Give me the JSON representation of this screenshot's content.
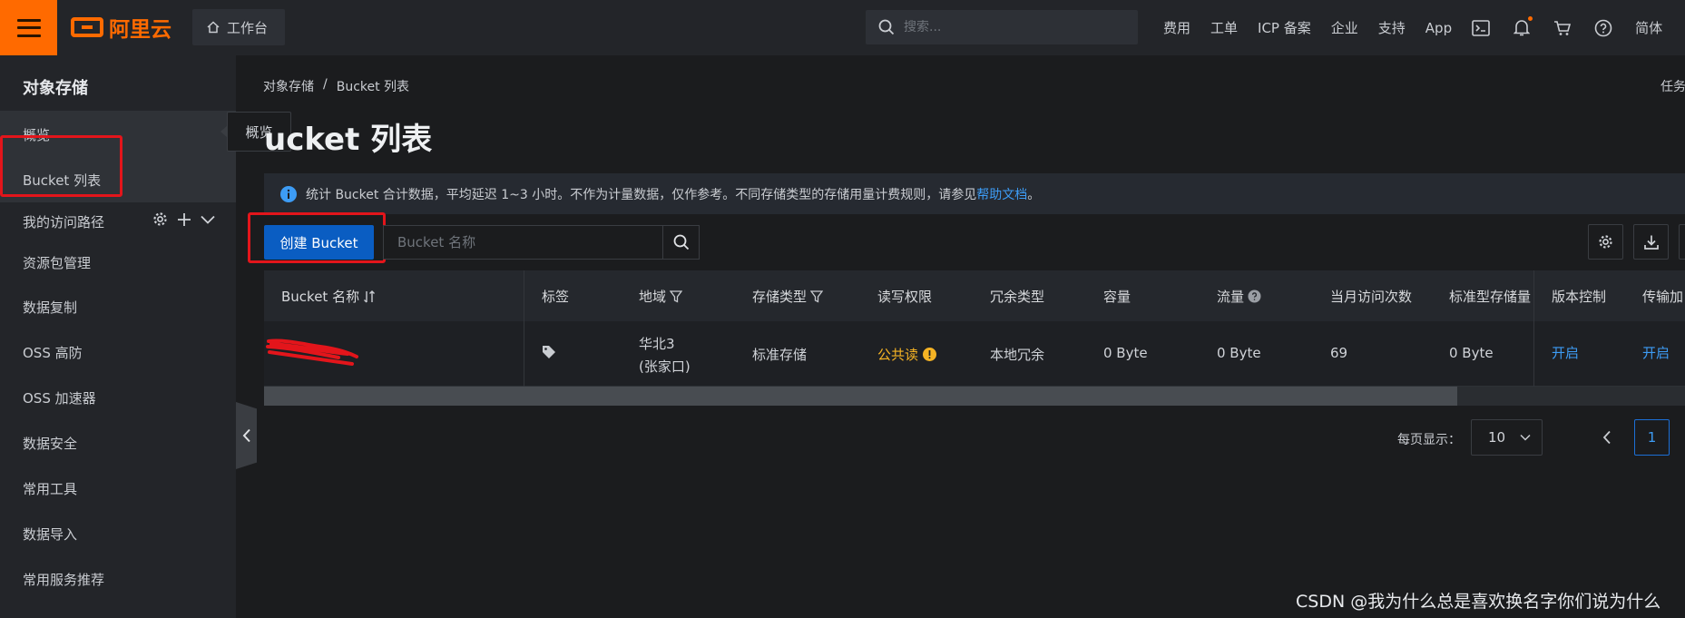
{
  "topbar": {
    "brand": "阿里云",
    "workbench": "工作台",
    "search_placeholder": "搜索...",
    "nav": [
      "费用",
      "工单",
      "ICP 备案",
      "企业",
      "支持",
      "App"
    ],
    "lang": "简体"
  },
  "sidebar": {
    "title": "对象存储",
    "items": {
      "overview": "概览",
      "bucket_list": "Bucket 列表",
      "my_routes": "我的访问路径",
      "resource_pkg": "资源包管理",
      "replication": "数据复制",
      "oss_ddos": "OSS 高防",
      "accelerator": "OSS 加速器",
      "security": "数据安全",
      "tools": "常用工具",
      "import": "数据导入",
      "recommend": "常用服务推荐"
    },
    "tooltip": "概览"
  },
  "main": {
    "breadcrumb": [
      "对象存储",
      "/",
      "Bucket 列表"
    ],
    "tasks": "任务",
    "title": "ucket 列表",
    "notice_text": "统计 Bucket 合计数据，平均延迟 1~3 小时。不作为计量数据，仅作参考。不同存储类型的存储用量计费规则，请参见",
    "notice_link": "帮助文档",
    "notice_end": "。",
    "create_button": "创建 Bucket",
    "search_placeholder": "Bucket 名称"
  },
  "table": {
    "headers": {
      "name": "Bucket 名称",
      "tags": "标签",
      "region": "地域",
      "storage_class": "存储类型",
      "acl": "读写权限",
      "redundancy": "冗余类型",
      "capacity": "容量",
      "traffic": "流量",
      "monthly_requests": "当月访问次数",
      "standard_usage": "标准型存储量",
      "versioning": "版本控制",
      "transfer_accel": "传输加"
    },
    "row": {
      "region_line1": "华北3",
      "region_line2": "(张家口)",
      "storage_class": "标准存储",
      "acl": "公共读",
      "redundancy": "本地冗余",
      "capacity": "0 Byte",
      "traffic": "0 Byte",
      "monthly_requests": "69",
      "standard_usage": "0 Byte",
      "versioning": "开启",
      "transfer_accel": "开启"
    }
  },
  "pagination": {
    "per_page_label": "每页显示：",
    "per_page": "10",
    "current_page": "1"
  },
  "watermark": "CSDN @我为什么总是喜欢换名字你们说为什么",
  "colors": {
    "accent": "#ff6a00",
    "primary": "#0a5dc2",
    "link": "#3d9cf5",
    "warning": "#f5b324",
    "annotation": "#e3151b"
  }
}
